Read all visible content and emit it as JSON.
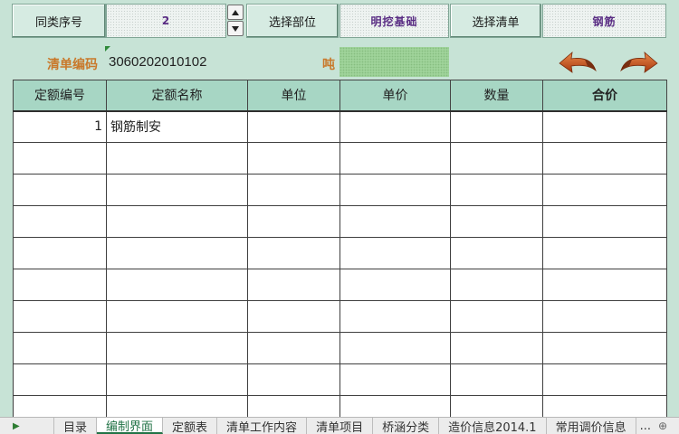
{
  "toolbar": {
    "seq_label": "同类序号",
    "seq_value": "2",
    "select_part_label": "选择部位",
    "part_value": "明挖基础",
    "select_list_label": "选择清单",
    "list_value": "钢筋"
  },
  "info": {
    "code_label": "清单编码",
    "code_value": "3060202010102",
    "unit_label": "吨"
  },
  "table": {
    "headers": [
      "定额编号",
      "定额名称",
      "单位",
      "单价",
      "数量",
      "合价"
    ],
    "rows": [
      [
        "1",
        "钢筋制安",
        "",
        "",
        "",
        ""
      ],
      [
        "",
        "",
        "",
        "",
        "",
        ""
      ],
      [
        "",
        "",
        "",
        "",
        "",
        ""
      ],
      [
        "",
        "",
        "",
        "",
        "",
        ""
      ],
      [
        "",
        "",
        "",
        "",
        "",
        ""
      ],
      [
        "",
        "",
        "",
        "",
        "",
        ""
      ],
      [
        "",
        "",
        "",
        "",
        "",
        ""
      ],
      [
        "",
        "",
        "",
        "",
        "",
        ""
      ],
      [
        "",
        "",
        "",
        "",
        "",
        ""
      ],
      [
        "",
        "",
        "",
        "",
        "",
        ""
      ]
    ]
  },
  "sheet_tabs": [
    "目录",
    "编制界面",
    "定额表",
    "清单工作内容",
    "清单项目",
    "桥涵分类",
    "造价信息2014.1",
    "常用调价信息"
  ],
  "active_tab": "编制界面",
  "tabs_overflow": "...",
  "icons": {
    "back": "curved-left-arrow-icon",
    "forward": "curved-right-arrow-icon",
    "spin_up": "spin-up-icon",
    "spin_down": "spin-down-icon",
    "sheet_nav": "sheet-nav-right-icon",
    "add_sheet": "add-sheet-icon"
  },
  "colors": {
    "background": "#c7e3d6",
    "header_fill": "#a7d6c4",
    "label_orange": "#c9782a",
    "value_purple": "#5a2d84",
    "unit_fill": "#9fd39a",
    "arrow": "#c8541c"
  }
}
